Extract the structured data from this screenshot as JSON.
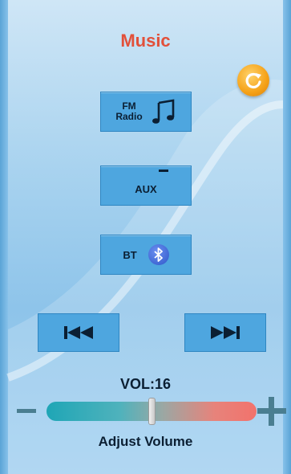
{
  "title": "Music",
  "buttons": {
    "fm_line1": "FM",
    "fm_line2": "Radio",
    "aux": "AUX",
    "bt": "BT"
  },
  "icons": {
    "refresh": "refresh-icon",
    "fm": "music-note-icon",
    "bt": "bluetooth-icon",
    "prev": "skip-previous-icon",
    "next": "skip-next-icon",
    "minus": "minus-icon",
    "plus": "plus-icon"
  },
  "volume": {
    "label": "VOL:16",
    "value": 16,
    "max": 32,
    "caption": "Adjust Volume"
  },
  "colors": {
    "title": "#e2503a",
    "button": "#4ea6df",
    "refresh": "#f5a117"
  }
}
